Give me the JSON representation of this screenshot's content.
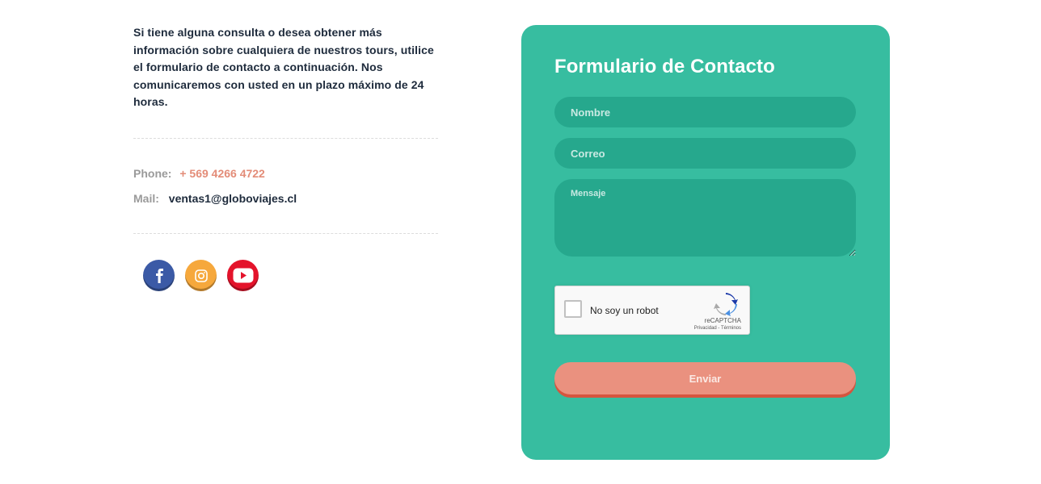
{
  "intro": {
    "text": "Si tiene alguna consulta o desea obtener más información sobre cualquiera de nuestros tours, utilice el formulario de contacto a continuación. Nos comunicaremos con usted en un plazo máximo de 24 horas."
  },
  "contact": {
    "phone_label": "Phone:",
    "phone_value": "+ 569 4266 4722",
    "mail_label": "Mail:",
    "mail_value": "ventas1@globoviajes.cl"
  },
  "social": [
    {
      "name": "facebook-icon",
      "color": "#3b5aa6"
    },
    {
      "name": "instagram-icon",
      "color": "#f6a83c"
    },
    {
      "name": "youtube-icon",
      "color": "#e4132b"
    }
  ],
  "form": {
    "title": "Formulario de Contacto",
    "name_placeholder": "Nombre",
    "email_placeholder": "Correo",
    "message_placeholder": "Mensaje",
    "submit_label": "Enviar",
    "card_color": "#37bda0",
    "field_color": "#26a88d",
    "button_color": "#ea917f"
  },
  "captcha": {
    "label": "No soy un robot",
    "brand": "reCAPTCHA",
    "links": "Privacidad - Términos"
  }
}
